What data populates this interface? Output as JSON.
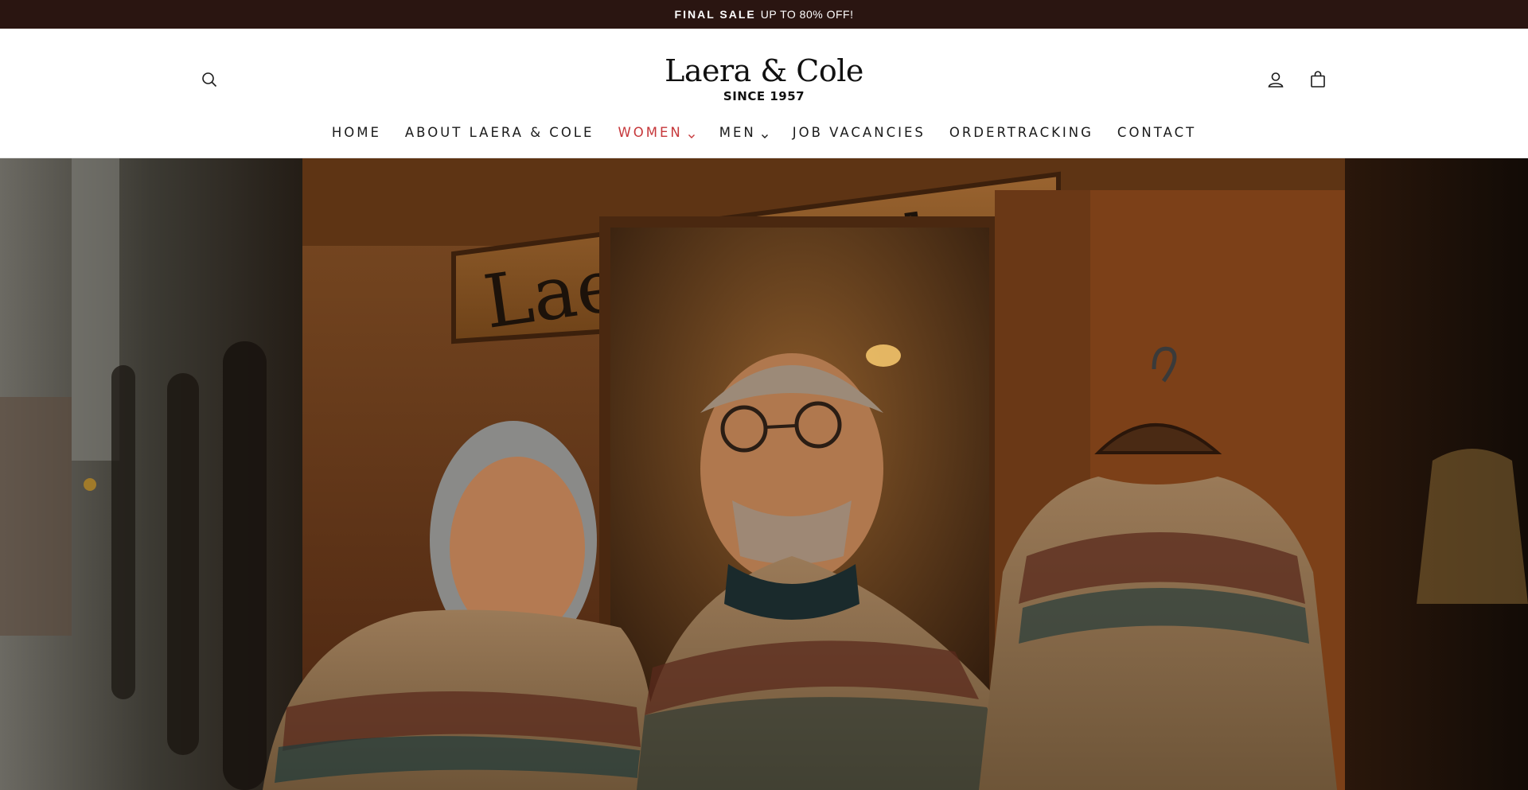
{
  "announcement": {
    "strong": "FINAL SALE",
    "text": "UP TO 80% OFF!"
  },
  "brand": {
    "name": "Laera & Cole",
    "tagline": "SINCE 1957"
  },
  "header_icons": {
    "search": "search-icon",
    "account": "user-icon",
    "cart": "bag-icon"
  },
  "nav": {
    "items": [
      {
        "label": "HOME"
      },
      {
        "label": "ABOUT LAERA & COLE"
      },
      {
        "label": "WOMEN",
        "dropdown": true,
        "active": true
      },
      {
        "label": "MEN",
        "dropdown": true
      },
      {
        "label": "JOB VACANCIES"
      },
      {
        "label": "ORDERTRACKING"
      },
      {
        "label": "CONTACT"
      }
    ]
  },
  "hero": {
    "sign_text": "Laera & Cole"
  },
  "colors": {
    "announce_bg": "#2a1511",
    "accent": "#c6373a"
  }
}
